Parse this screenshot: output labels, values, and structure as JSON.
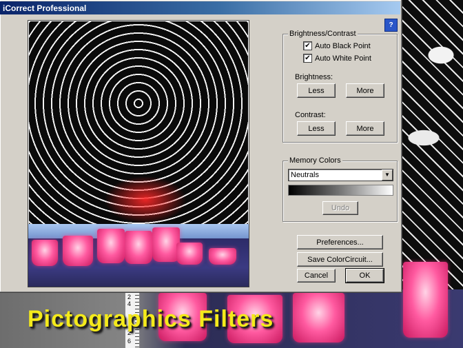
{
  "window": {
    "title": "iCorrect Professional"
  },
  "brightness_contrast": {
    "group_label": "Brightness/Contrast",
    "auto_black_point": {
      "label": "Auto Black Point",
      "checked": true
    },
    "auto_white_point": {
      "label": "Auto White Point",
      "checked": true
    },
    "brightness_label": "Brightness:",
    "contrast_label": "Contrast:",
    "less_label": "Less",
    "more_label": "More"
  },
  "memory_colors": {
    "group_label": "Memory Colors",
    "selected": "Neutrals",
    "undo_label": "Undo"
  },
  "buttons": {
    "preferences": "Preferences...",
    "save_colorcircuit": "Save ColorCircuit...",
    "cancel": "Cancel",
    "ok": "OK"
  },
  "ruler": {
    "ticks": [
      "2",
      "4",
      "2",
      "6"
    ]
  },
  "banner": {
    "text": "Pictographics Filters"
  },
  "icons": {
    "help": "help-icon",
    "dropdown": "chevron-down-icon",
    "check": "checkmark-icon"
  },
  "colors": {
    "title_bar": "#0a246a",
    "dialog_face": "#d4d0c8",
    "banner_text": "#f4ea1b"
  }
}
